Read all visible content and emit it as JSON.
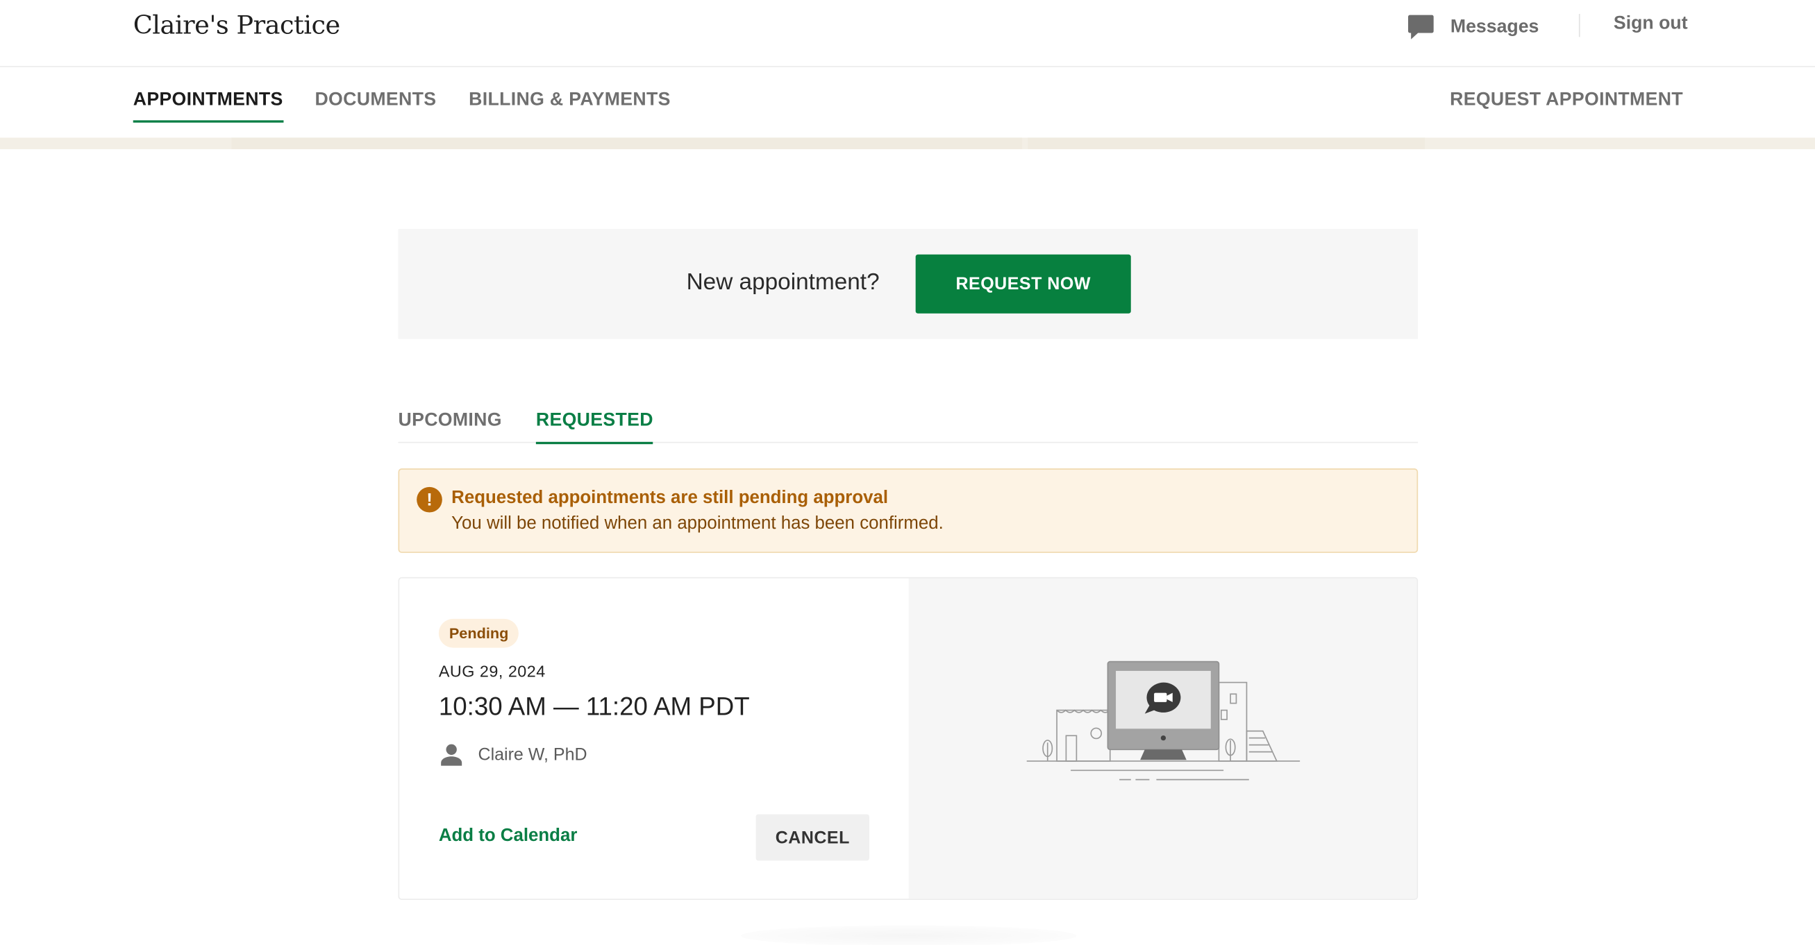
{
  "header": {
    "practice_name": "Claire's Practice",
    "messages_label": "Messages",
    "sign_out_label": "Sign out"
  },
  "nav": {
    "tabs": [
      {
        "label": "APPOINTMENTS",
        "active": true
      },
      {
        "label": "DOCUMENTS",
        "active": false
      },
      {
        "label": "BILLING & PAYMENTS",
        "active": false
      }
    ],
    "request_appointment_label": "REQUEST APPOINTMENT"
  },
  "cta": {
    "text": "New appointment?",
    "button_label": "REQUEST NOW"
  },
  "tabs": {
    "upcoming_label": "UPCOMING",
    "requested_label": "REQUESTED",
    "active": "REQUESTED"
  },
  "alert": {
    "title": "Requested appointments are still pending approval",
    "body": "You will be notified when an appointment has been confirmed.",
    "icon": "!"
  },
  "appointment": {
    "status": "Pending",
    "date": "AUG 29, 2024",
    "time": "10:30 AM — 11:20 AM PDT",
    "provider": "Claire W, PhD",
    "add_to_calendar_label": "Add to Calendar",
    "cancel_label": "CANCEL"
  },
  "icons": {
    "messages": "speech-bubble-icon",
    "provider": "person-icon",
    "illustration": "video-call-computer-illustration"
  },
  "colors": {
    "brand_green": "#07803f",
    "alert_bg": "#fdf3e4",
    "alert_text": "#a95f06",
    "badge_bg": "#fdf0df"
  }
}
